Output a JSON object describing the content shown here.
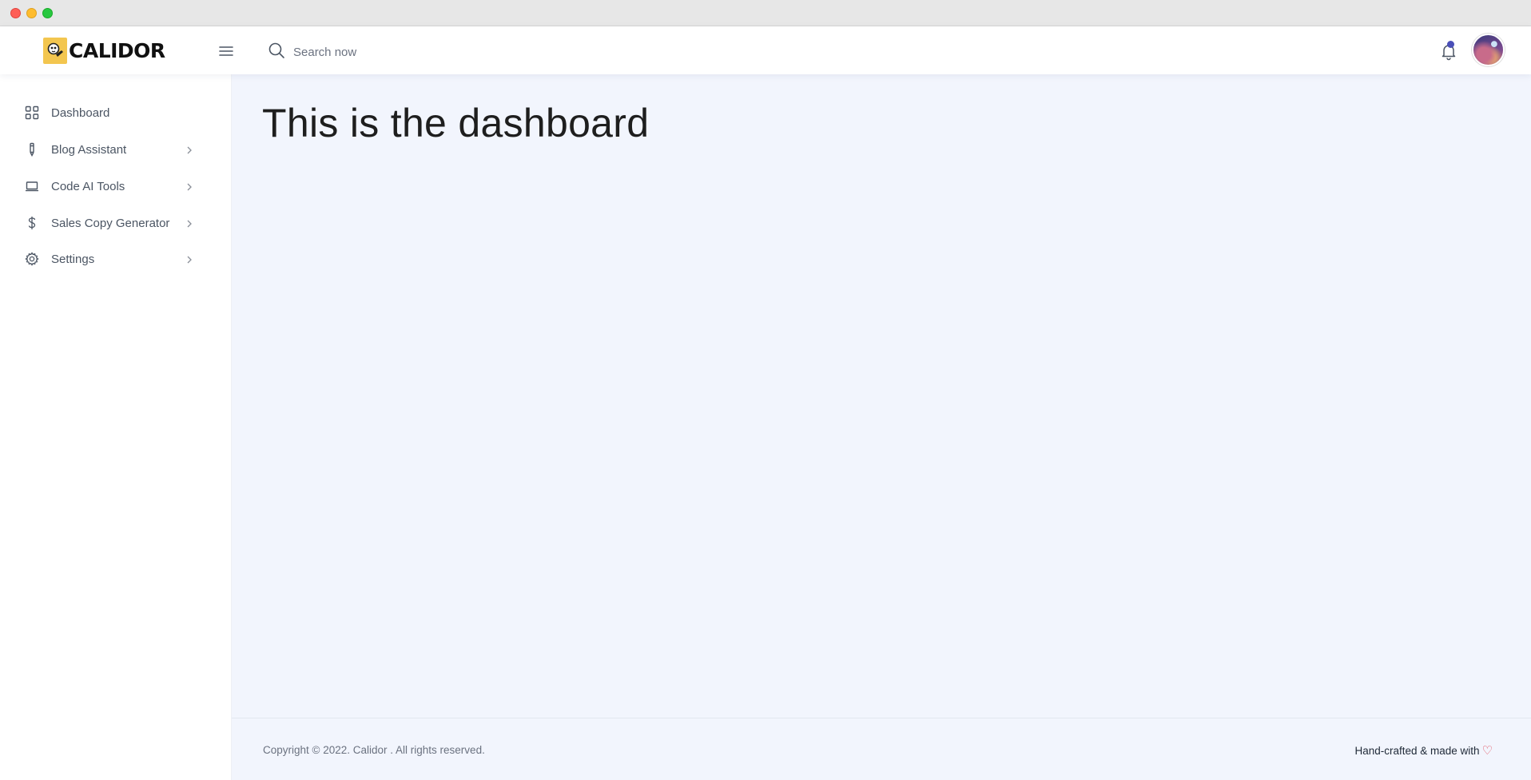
{
  "window": {
    "controls": [
      "close",
      "minimize",
      "maximize"
    ]
  },
  "header": {
    "logo_text": "CALIDOR",
    "menu_icon": "hamburger-icon",
    "search": {
      "placeholder": "Search now",
      "value": "",
      "icon": "search-icon"
    },
    "notification_icon": "bell-icon",
    "has_notification": true,
    "avatar_icon": "user-avatar"
  },
  "sidebar": {
    "items": [
      {
        "label": "Dashboard",
        "icon": "grid-icon",
        "has_submenu": false
      },
      {
        "label": "Blog Assistant",
        "icon": "pen-icon",
        "has_submenu": true
      },
      {
        "label": "Code AI Tools",
        "icon": "laptop-icon",
        "has_submenu": true
      },
      {
        "label": "Sales Copy Generator",
        "icon": "dollar-icon",
        "has_submenu": true
      },
      {
        "label": "Settings",
        "icon": "gear-icon",
        "has_submenu": true
      }
    ]
  },
  "main": {
    "title": "This is the dashboard"
  },
  "footer": {
    "copyright": "Copyright © 2022. Calidor . All rights reserved.",
    "crafted": "Hand-crafted & made with",
    "heart": "♡"
  },
  "colors": {
    "accent": "#4a4fb8",
    "logo_bg": "#f3c64f",
    "main_bg": "#f2f5fd",
    "heart": "#e04a5a"
  }
}
